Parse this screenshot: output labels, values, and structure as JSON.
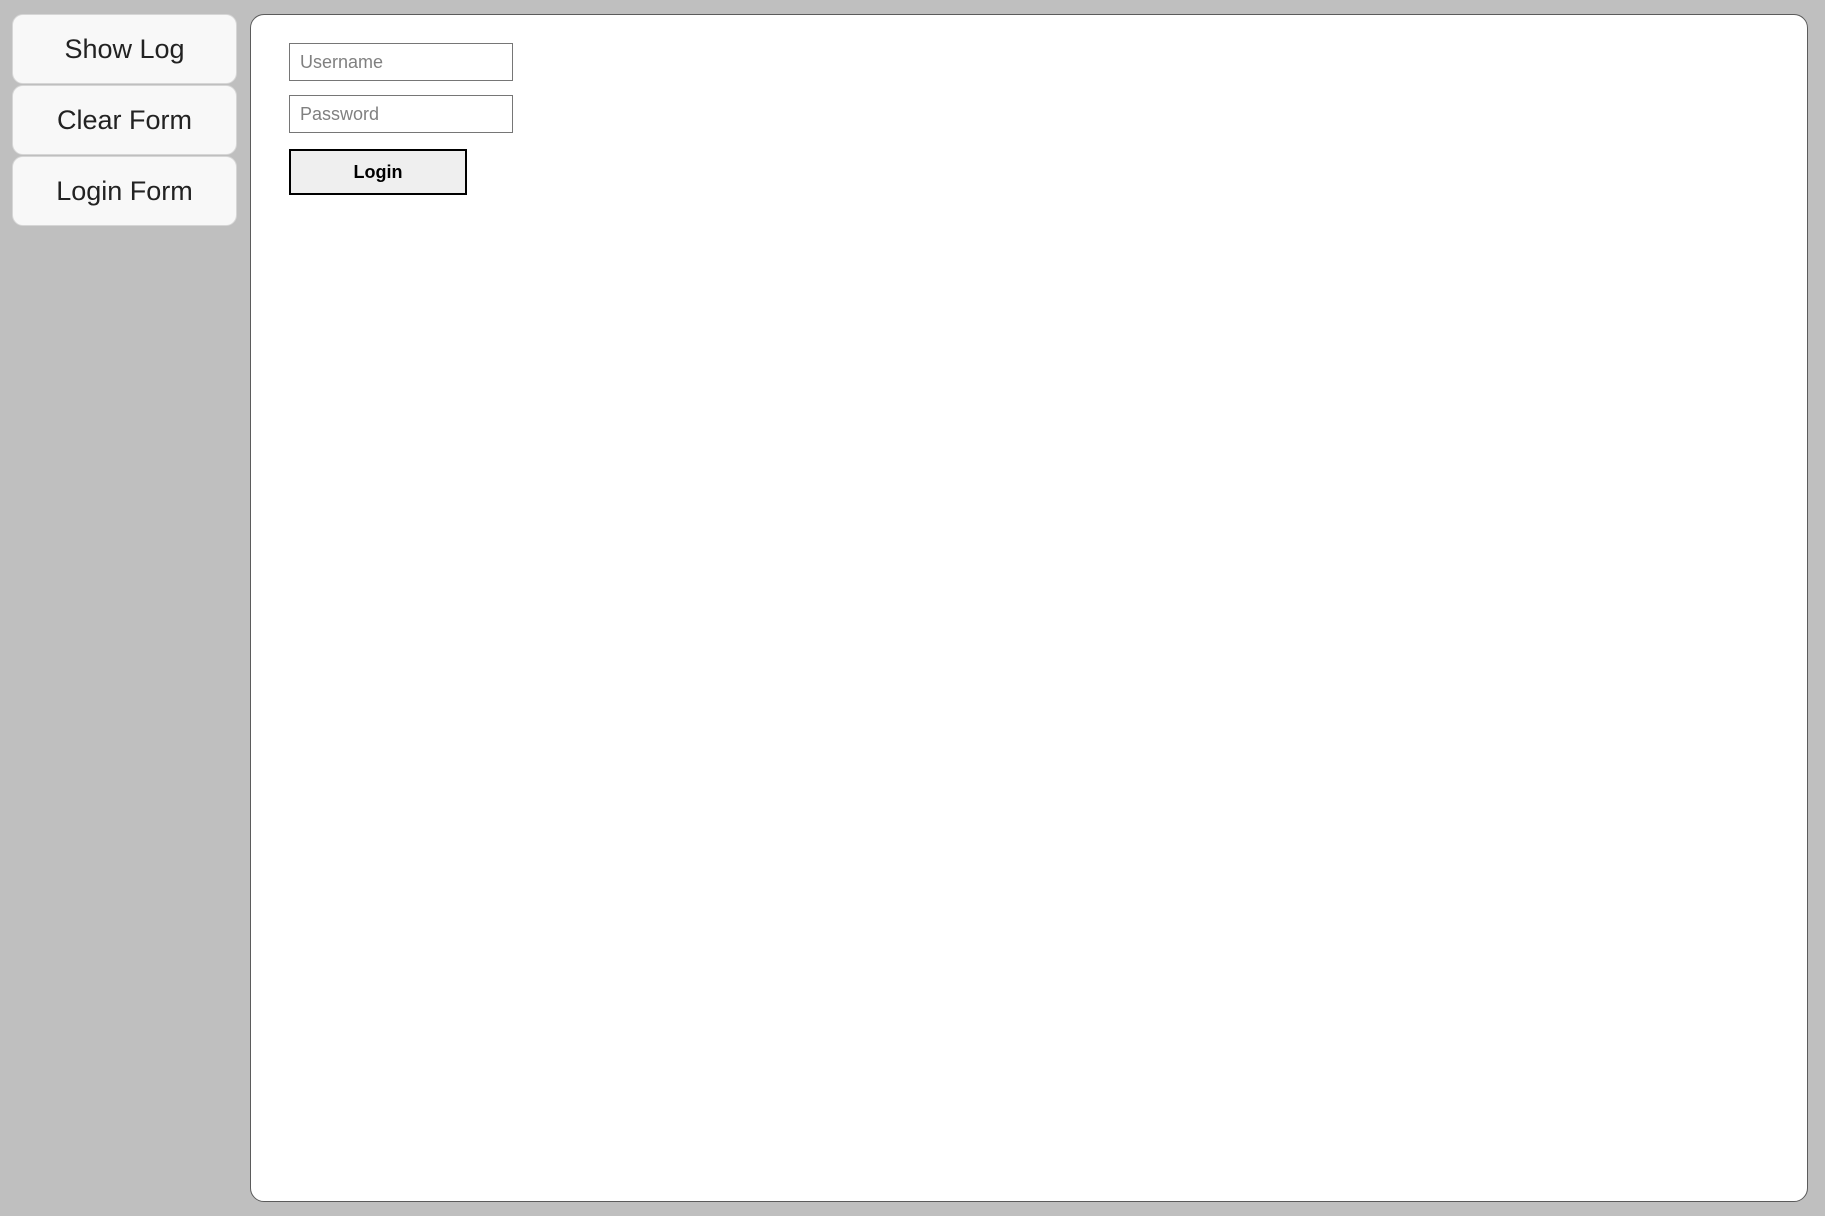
{
  "sidebar": {
    "buttons": [
      {
        "label": "Show Log"
      },
      {
        "label": "Clear Form"
      },
      {
        "label": "Login Form"
      }
    ]
  },
  "form": {
    "username_placeholder": "Username",
    "username_value": "",
    "password_placeholder": "Password",
    "password_value": "",
    "login_label": "Login"
  }
}
